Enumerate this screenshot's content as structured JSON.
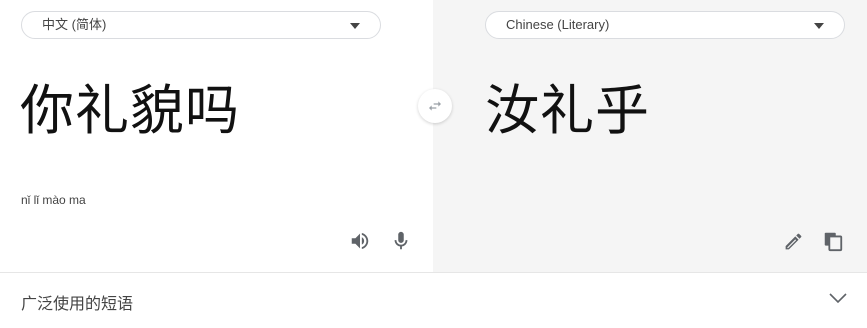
{
  "source": {
    "language": "中文 (简体)",
    "text": "你礼貌吗",
    "romanization": "nǐ lǐ mào ma"
  },
  "target": {
    "language": "Chinese (Literary)",
    "text": "汝礼乎"
  },
  "phrases": {
    "label": "广泛使用的短语"
  },
  "icons": {
    "swap": "swap-arrows-icon",
    "speaker": "speaker-icon",
    "mic": "microphone-icon",
    "pencil": "pencil-icon",
    "copy": "copy-icon",
    "chevron": "chevron-down-icon"
  },
  "colors": {
    "icon": "#5f6368",
    "pane_right_bg": "#f5f5f5"
  }
}
